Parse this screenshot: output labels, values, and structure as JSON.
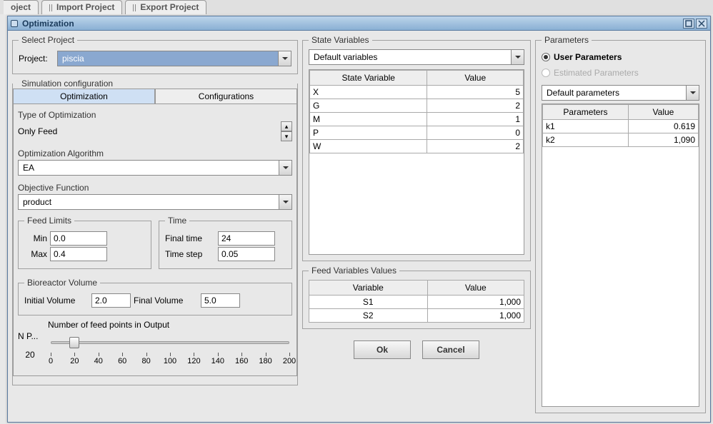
{
  "bg_tabs": {
    "partial": "oject",
    "import": "Import Project",
    "export": "Export Project"
  },
  "dialog_title": "Optimization",
  "select_project": {
    "legend": "Select Project",
    "label": "Project:",
    "value": "piscia"
  },
  "sim_conf_legend": "Simulation configuration",
  "tabs": {
    "opt": "Optimization",
    "conf": "Configurations"
  },
  "type_opt_label": "Type of Optimization",
  "type_opt_value": "Only Feed",
  "algo_label": "Optimization Algorithm",
  "algo_value": "EA",
  "obj_label": "Objective Function",
  "obj_value": "product",
  "feed_limits": {
    "legend": "Feed Limits",
    "min_lbl": "Min",
    "min_val": "0.0",
    "max_lbl": "Max",
    "max_val": "0.4"
  },
  "time": {
    "legend": "Time",
    "final_lbl": "Final time",
    "final_val": "24",
    "step_lbl": "Time step",
    "step_val": "0.05"
  },
  "bioreactor": {
    "legend": "Bioreactor Volume",
    "init_lbl": "Initial Volume",
    "init_val": "2.0",
    "final_lbl": "Final Volume",
    "final_val": "5.0"
  },
  "np": {
    "short": "N P...",
    "value": "20",
    "full": "Number of feed points in Output",
    "ticks": [
      "0",
      "20",
      "40",
      "60",
      "80",
      "100",
      "120",
      "140",
      "160",
      "180",
      "200"
    ]
  },
  "state_vars": {
    "legend": "State Variables",
    "combo": "Default variables",
    "hdr_var": "State Variable",
    "hdr_val": "Value",
    "rows": [
      {
        "name": "X",
        "val": "5"
      },
      {
        "name": "G",
        "val": "2"
      },
      {
        "name": "M",
        "val": "1"
      },
      {
        "name": "P",
        "val": "0"
      },
      {
        "name": "W",
        "val": "2"
      }
    ]
  },
  "feed_vars": {
    "legend": "Feed Variables Values",
    "hdr_var": "Variable",
    "hdr_val": "Value",
    "rows": [
      {
        "name": "S1",
        "val": "1,000"
      },
      {
        "name": "S2",
        "val": "1,000"
      }
    ]
  },
  "parameters": {
    "legend": "Parameters",
    "user": "User Parameters",
    "est": "Estimated Parameters",
    "combo": "Default parameters",
    "hdr_par": "Parameters",
    "hdr_val": "Value",
    "rows": [
      {
        "name": "k1",
        "val": "0.619"
      },
      {
        "name": "k2",
        "val": "1,090"
      }
    ]
  },
  "buttons": {
    "ok": "Ok",
    "cancel": "Cancel"
  }
}
